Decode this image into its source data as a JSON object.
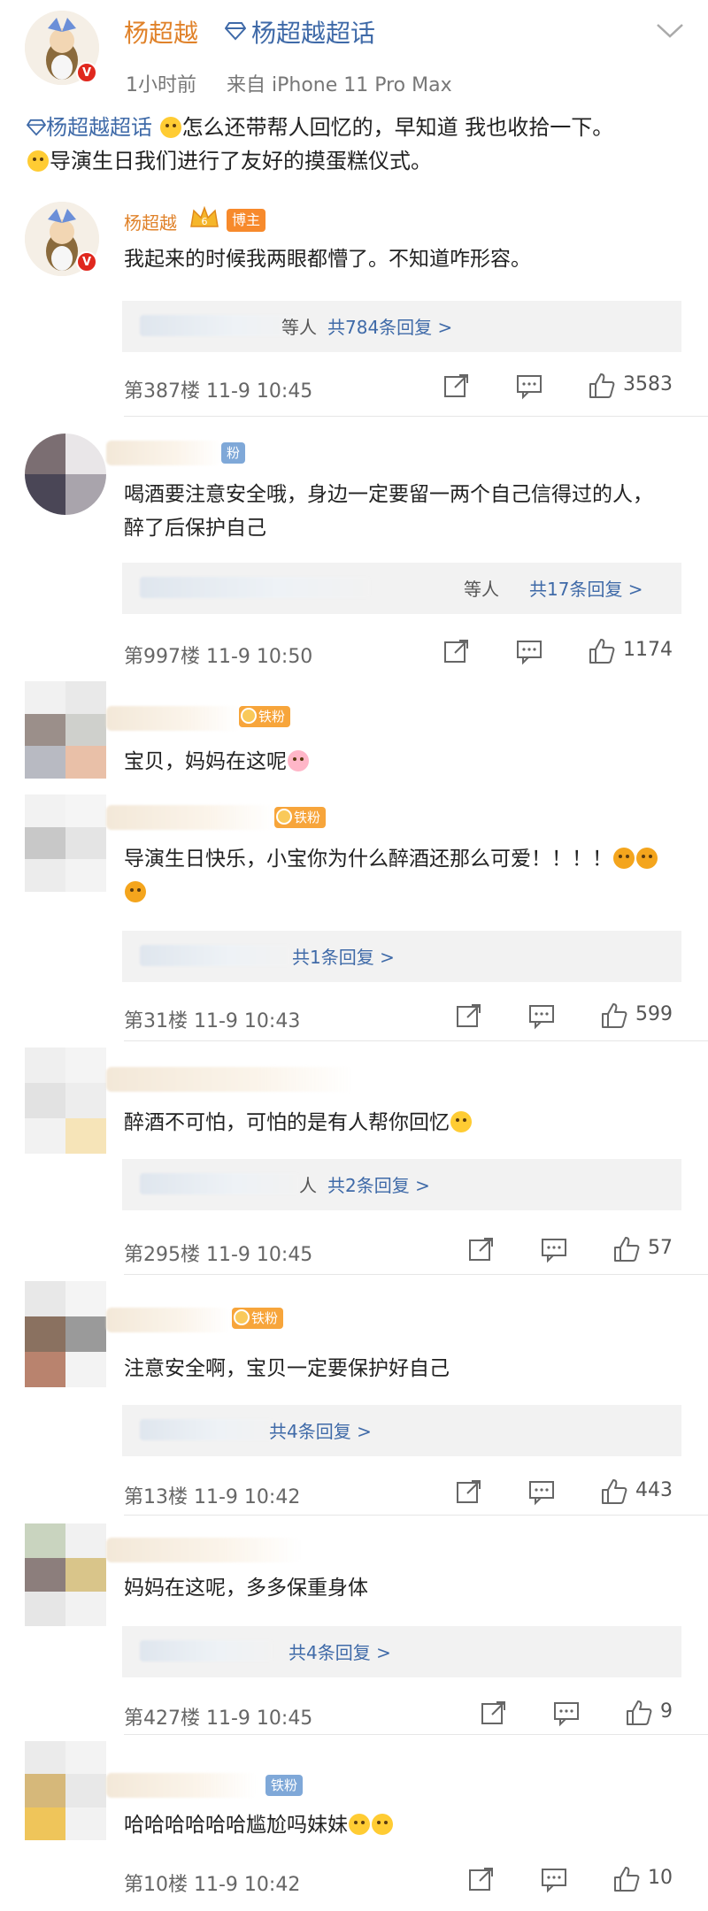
{
  "post": {
    "author": "杨超越",
    "topic": "杨超越超话",
    "time": "1小时前",
    "source": "来自 iPhone 11 Pro Max",
    "topic_link": "杨超越超话",
    "line1": "怎么还带帮人回忆的，早知道 我也收拾一下。",
    "line2": "导演生日我们进行了友好的摸蛋糕仪式。"
  },
  "colors": {
    "accent": "#e0822a",
    "link": "#3f6aa8",
    "verified": "#e0281e",
    "fan": "#f7a53b"
  },
  "comments": [
    {
      "name": "杨超越",
      "badge": "博主",
      "text": "我起来的时候我两眼都懵了。不知道咋形容。",
      "reply_who": "等人",
      "reply_count": "共784条回复 >",
      "floor": "第387楼 11-9 10:45",
      "likes": "3583"
    },
    {
      "badge": "粉",
      "text": "喝酒要注意安全哦，身边一定要留一两个自己信得过的人，醉了后保护自己",
      "reply_who": "等人",
      "reply_count": "共17条回复 >",
      "floor": "第997楼 11-9 10:50",
      "likes": "1174"
    },
    {
      "badge": "铁粉",
      "text": "宝贝，妈妈在这呢"
    },
    {
      "badge": "铁粉",
      "text": "导演生日快乐，小宝你为什么醉酒还那么可爱！！！！",
      "reply_count": "共1条回复 >",
      "floor": "第31楼 11-9 10:43",
      "likes": "599"
    },
    {
      "text": "醉酒不可怕，可怕的是有人帮你回忆",
      "reply_who": "人",
      "reply_count": "共2条回复 >",
      "floor": "第295楼 11-9 10:45",
      "likes": "57"
    },
    {
      "badge": "铁粉",
      "text": "注意安全啊，宝贝一定要保护好自己",
      "reply_count": "共4条回复 >",
      "floor": "第13楼 11-9 10:42",
      "likes": "443"
    },
    {
      "text": "妈妈在这呢，多多保重身体",
      "reply_count": "共4条回复 >",
      "floor": "第427楼 11-9 10:45",
      "likes": "9"
    },
    {
      "badge": "铁粉",
      "text": "哈哈哈哈哈哈尴尬吗妹妹",
      "floor": "第10楼 11-9 10:42",
      "likes": "10"
    }
  ]
}
